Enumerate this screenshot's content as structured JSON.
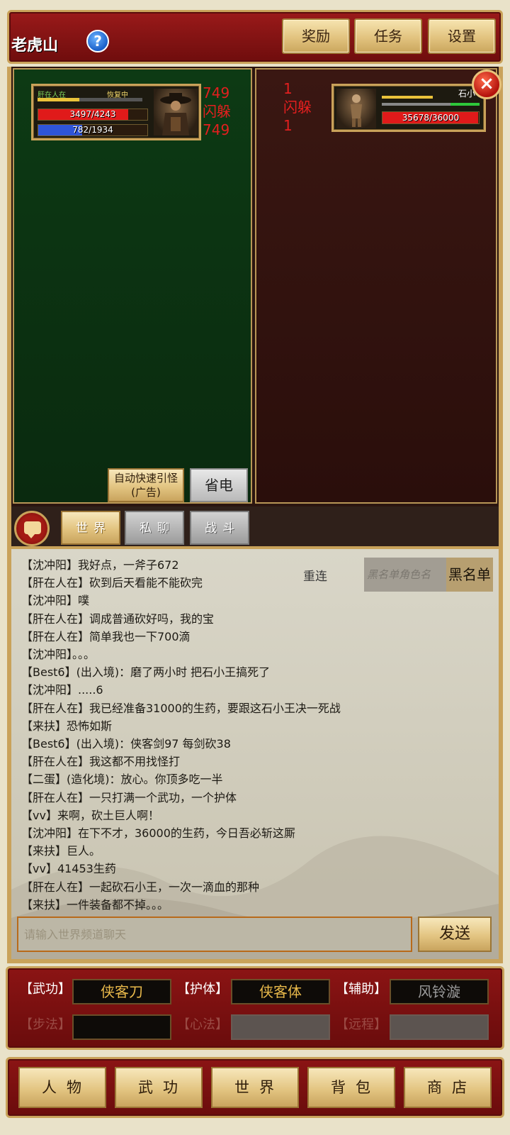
{
  "header": {
    "location": "老虎山",
    "help_icon": "?",
    "buttons": {
      "reward": "奖励",
      "task": "任务",
      "settings": "设置"
    }
  },
  "battle": {
    "player": {
      "name": "肝在人在",
      "status": "恢复中",
      "hp_text": "3497/4243",
      "hp_fraction": 0.824,
      "mp_text": "782/1934",
      "mp_fraction": 0.404,
      "floats": [
        "749",
        "闪躲",
        "749"
      ]
    },
    "enemy": {
      "name": "石小",
      "hp_text": "35678/36000",
      "hp_fraction": 0.991,
      "floats": [
        "1",
        "闪躲",
        "1"
      ]
    },
    "close_icon": "×",
    "auto_btn_line1": "自动快速引怪",
    "auto_btn_line2": "(广告)",
    "power_save_btn": "省电"
  },
  "chat": {
    "tabs": {
      "world": "世界",
      "private": "私聊",
      "combat": "战斗"
    },
    "reconnect": "重连",
    "blacklist_placeholder": "黑名单角色名",
    "blacklist_btn": "黑名单",
    "input_placeholder": "请输入世界频道聊天",
    "send_btn": "发送",
    "messages": [
      "【沈冲阳】我好点，一斧子672",
      "【肝在人在】砍到后天看能不能砍完",
      "【沈冲阳】噗",
      "【肝在人在】调成普通砍好吗，我的宝",
      "【肝在人在】简单我也一下700滴",
      "【沈冲阳】。。。",
      "【Best6】(出入境)：磨了两小时 把石小王搞死了",
      "【沈冲阳】.....6",
      "【肝在人在】我已经准备31000的生药，要跟这石小王决一死战",
      "【来扶】恐怖如斯",
      "【Best6】(出入境)：侠客剑97 每剑砍38",
      "【肝在人在】我这都不用找怪打",
      "【二蛋】(造化境)：放心。你顶多吃一半",
      "【肝在人在】一只打满一个武功，一个护体",
      "【vv】来啊，砍土巨人啊！",
      "【沈冲阳】在下不才，36000的生药，今日吾必斩这厮",
      "【来扶】巨人。",
      "【vv】41453生药",
      "【肝在人在】一起砍石小王，一次一滴血的那种",
      "【来扶】一件装备都不掉。。。"
    ]
  },
  "skills": {
    "wugong_label": "【武功】",
    "wugong_value": "侠客刀",
    "huti_label": "【护体】",
    "huti_value": "侠客体",
    "fuzhu_label": "【辅助】",
    "fuzhu_value": "风铃漩",
    "bufa_label": "【步法】",
    "xinfa_label": "【心法】",
    "yuancheng_label": "【远程】"
  },
  "nav": {
    "character": "人物",
    "martial": "武功",
    "world": "世界",
    "bag": "背包",
    "shop": "商店"
  },
  "colors": {
    "hp": "#e01a1a",
    "mp": "#2f55d8",
    "float_damage": "#e31f1f",
    "frame_gold": "#c9a25a",
    "panel_red": "#8b1414",
    "skill_gold_text": "#e8b84a"
  }
}
